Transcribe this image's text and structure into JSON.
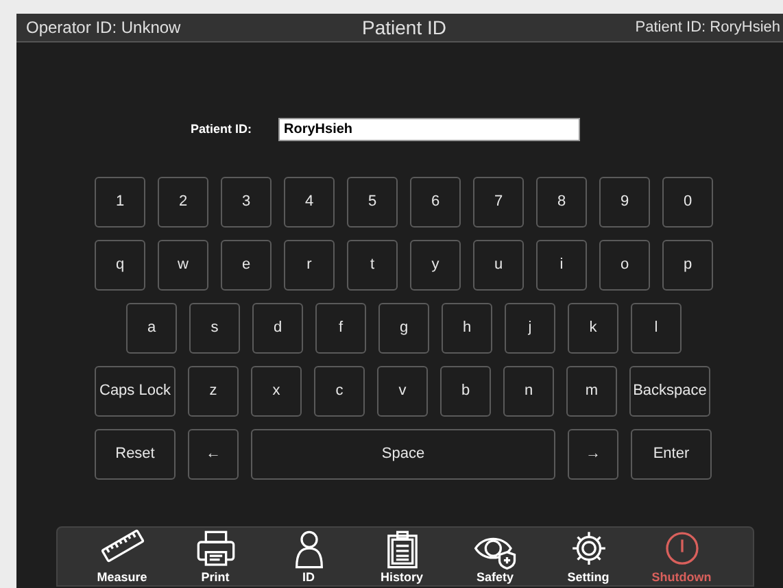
{
  "header": {
    "operator": "Operator ID: Unknow",
    "title": "Patient ID",
    "patient": "Patient ID: RoryHsieh"
  },
  "form": {
    "label": "Patient ID:",
    "value": "RoryHsieh"
  },
  "keyboard": {
    "rows": [
      {
        "keys": [
          {
            "label": "1",
            "kind": "char"
          },
          {
            "label": "2",
            "kind": "char"
          },
          {
            "label": "3",
            "kind": "char"
          },
          {
            "label": "4",
            "kind": "char"
          },
          {
            "label": "5",
            "kind": "char"
          },
          {
            "label": "6",
            "kind": "char"
          },
          {
            "label": "7",
            "kind": "char"
          },
          {
            "label": "8",
            "kind": "char"
          },
          {
            "label": "9",
            "kind": "char"
          },
          {
            "label": "0",
            "kind": "char"
          }
        ]
      },
      {
        "keys": [
          {
            "label": "q",
            "kind": "char"
          },
          {
            "label": "w",
            "kind": "char"
          },
          {
            "label": "e",
            "kind": "char"
          },
          {
            "label": "r",
            "kind": "char"
          },
          {
            "label": "t",
            "kind": "char"
          },
          {
            "label": "y",
            "kind": "char"
          },
          {
            "label": "u",
            "kind": "char"
          },
          {
            "label": "i",
            "kind": "char"
          },
          {
            "label": "o",
            "kind": "char"
          },
          {
            "label": "p",
            "kind": "char"
          }
        ]
      },
      {
        "keys": [
          {
            "label": "a",
            "kind": "char"
          },
          {
            "label": "s",
            "kind": "char"
          },
          {
            "label": "d",
            "kind": "char"
          },
          {
            "label": "f",
            "kind": "char"
          },
          {
            "label": "g",
            "kind": "char"
          },
          {
            "label": "h",
            "kind": "char"
          },
          {
            "label": "j",
            "kind": "char"
          },
          {
            "label": "k",
            "kind": "char"
          },
          {
            "label": "l",
            "kind": "char"
          }
        ]
      },
      {
        "keys": [
          {
            "label": "Caps Lock",
            "kind": "wide"
          },
          {
            "label": "z",
            "kind": "char"
          },
          {
            "label": "x",
            "kind": "char"
          },
          {
            "label": "c",
            "kind": "char"
          },
          {
            "label": "v",
            "kind": "char"
          },
          {
            "label": "b",
            "kind": "char"
          },
          {
            "label": "n",
            "kind": "char"
          },
          {
            "label": "m",
            "kind": "char"
          },
          {
            "label": "Backspace",
            "kind": "wide"
          }
        ]
      },
      {
        "keys": [
          {
            "label": "Reset",
            "kind": "wide"
          },
          {
            "label": "←",
            "kind": "char"
          },
          {
            "label": "Space",
            "kind": "space"
          },
          {
            "label": "→",
            "kind": "char"
          },
          {
            "label": "Enter",
            "kind": "wide"
          }
        ]
      }
    ]
  },
  "nav": [
    {
      "label": "Measure",
      "kind": "normal"
    },
    {
      "label": "Print",
      "kind": "normal"
    },
    {
      "label": "ID",
      "kind": "normal"
    },
    {
      "label": "History",
      "kind": "normal"
    },
    {
      "label": "Safety",
      "kind": "normal"
    },
    {
      "label": "Setting",
      "kind": "normal"
    },
    {
      "label": "Shutdown",
      "kind": "danger"
    }
  ]
}
